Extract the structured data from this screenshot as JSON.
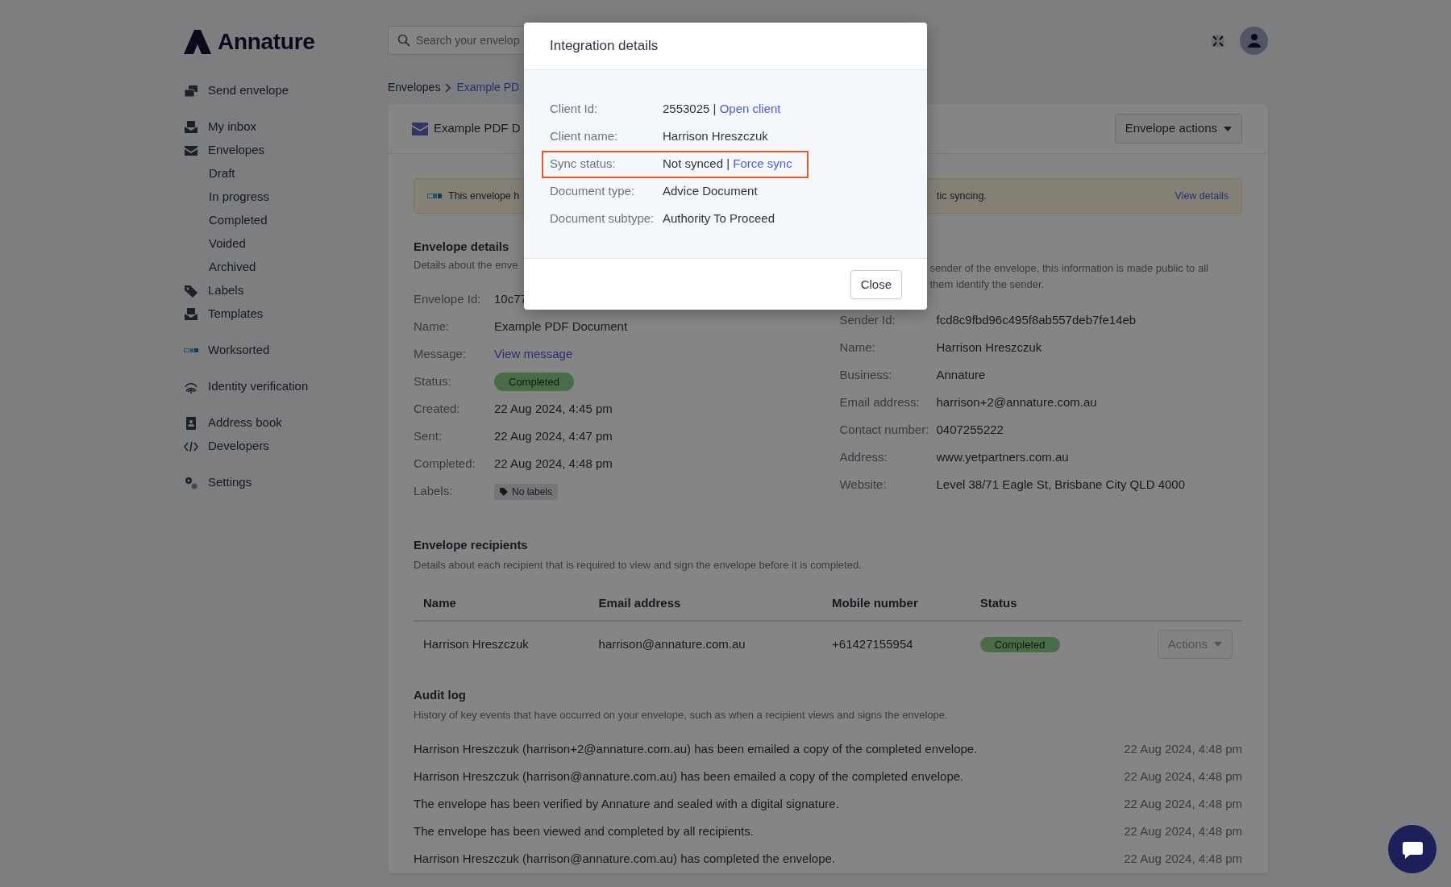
{
  "brand": {
    "name": "Annature"
  },
  "sidebar": {
    "groups": [
      [
        {
          "label": "Send envelope"
        }
      ],
      [
        {
          "label": "My inbox"
        },
        {
          "label": "Envelopes",
          "children": [
            {
              "label": "Draft"
            },
            {
              "label": "In progress"
            },
            {
              "label": "Completed"
            },
            {
              "label": "Voided"
            },
            {
              "label": "Archived"
            }
          ]
        },
        {
          "label": "Labels"
        },
        {
          "label": "Templates"
        }
      ],
      [
        {
          "label": "Worksorted"
        }
      ],
      [
        {
          "label": "Identity verification"
        }
      ],
      [
        {
          "label": "Address book"
        },
        {
          "label": "Developers"
        }
      ],
      [
        {
          "label": "Settings"
        }
      ]
    ]
  },
  "search": {
    "placeholder": "Search your envelop"
  },
  "breadcrumb": [
    {
      "label": "Envelopes",
      "current": false
    },
    {
      "label": "Example PD",
      "current": true
    }
  ],
  "card": {
    "title": "Example PDF D",
    "actions_button": "Envelope actions"
  },
  "alert": {
    "text_start": "This envelope h",
    "text_end": "tic syncing.",
    "link": "View details"
  },
  "envelope_details": {
    "title": "Envelope details",
    "description": "Details about the enve",
    "fields": [
      {
        "label": "Envelope Id:",
        "value": "10c77",
        "kind": "text"
      },
      {
        "label": "Name:",
        "value": "Example PDF Document",
        "kind": "text"
      },
      {
        "label": "Message:",
        "value": "View message",
        "kind": "link"
      },
      {
        "label": "Status:",
        "value": "Completed",
        "kind": "status"
      },
      {
        "label": "Created:",
        "value": "22 Aug 2024, 4:45 pm",
        "kind": "text"
      },
      {
        "label": "Sent:",
        "value": "22 Aug 2024, 4:47 pm",
        "kind": "text"
      },
      {
        "label": "Completed:",
        "value": "22 Aug 2024, 4:48 pm",
        "kind": "text"
      },
      {
        "label": "Labels:",
        "value": "No labels",
        "kind": "tag"
      }
    ]
  },
  "sender_details": {
    "description_lines": [
      "sender of the envelope, this information is made public to all",
      "them identify the sender."
    ],
    "fields": [
      {
        "label": "Sender Id:",
        "value": "fcd8c9fbd96c495f8ab557deb7fe14eb"
      },
      {
        "label": "Name:",
        "value": "Harrison Hreszczuk"
      },
      {
        "label": "Business:",
        "value": "Annature"
      },
      {
        "label": "Email address:",
        "value": "harrison+2@annature.com.au"
      },
      {
        "label": "Contact number:",
        "value": "0407255222"
      },
      {
        "label": "Address:",
        "value": "www.yetpartners.com.au"
      },
      {
        "label": "Website:",
        "value": "Level 38/71 Eagle St, Brisbane City QLD 4000"
      }
    ]
  },
  "recipients": {
    "title": "Envelope recipients",
    "description": "Details about each recipient that is required to view and sign the envelope before it is completed.",
    "columns": [
      "Name",
      "Email address",
      "Mobile number",
      "Status"
    ],
    "rows": [
      {
        "name": "Harrison Hreszczuk",
        "email": "harrison@annature.com.au",
        "mobile": "+61427155954",
        "status": "Completed",
        "action": "Actions",
        "disabled": true
      }
    ]
  },
  "audit_log": {
    "title": "Audit log",
    "description": "History of key events that have occurred on your envelope, such as when a recipient views and signs the envelope.",
    "entries": [
      {
        "text": "Harrison Hreszczuk (harrison+2@annature.com.au) has been emailed a copy of the completed envelope.",
        "time": "22 Aug 2024, 4:48 pm"
      },
      {
        "text": "Harrison Hreszczuk (harrison@annature.com.au) has been emailed a copy of the completed envelope.",
        "time": "22 Aug 2024, 4:48 pm"
      },
      {
        "text": "The envelope has been verified by Annature and sealed with a digital signature.",
        "time": "22 Aug 2024, 4:48 pm"
      },
      {
        "text": "The envelope has been viewed and completed by all recipients.",
        "time": "22 Aug 2024, 4:48 pm"
      },
      {
        "text": "Harrison Hreszczuk (harrison@annature.com.au) has completed the envelope.",
        "time": "22 Aug 2024, 4:48 pm"
      }
    ]
  },
  "modal": {
    "title": "Integration details",
    "fields": [
      {
        "label": "Client Id:",
        "value": "2553025 |",
        "link": "Open client",
        "highlighted": false
      },
      {
        "label": "Client name:",
        "value": "Harrison Hreszczuk",
        "highlighted": false
      },
      {
        "label": "Sync status:",
        "value": "Not synced |",
        "link": "Force sync",
        "highlighted": true
      },
      {
        "label": "Document type:",
        "value": "Advice Document",
        "highlighted": false
      },
      {
        "label": "Document subtype:",
        "value": "Authority To Proceed",
        "highlighted": false
      }
    ],
    "close_button": "Close"
  }
}
